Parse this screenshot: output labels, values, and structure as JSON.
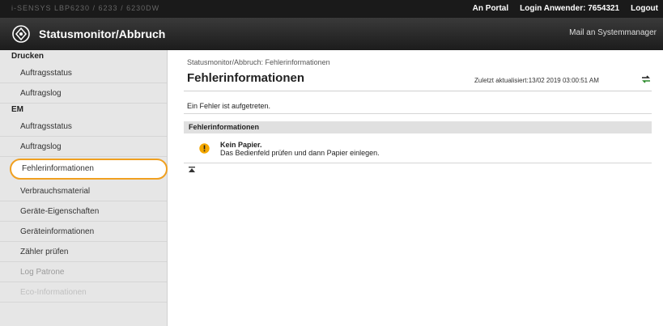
{
  "topbar": {
    "device_text": "i-SENSYS  LBP6230 / 6233 / 6230DW",
    "links": [
      "An Portal",
      "Login Anwender:  7654321",
      "Logout"
    ]
  },
  "titlebar": {
    "title": "Statusmonitor/Abbruch",
    "mail_link": "Mail an Systemmanager"
  },
  "sidebar": {
    "sections": [
      {
        "head": "Drucken",
        "items": [
          "Auftragsstatus",
          "Auftragslog"
        ]
      },
      {
        "head": "EM",
        "items": [
          "Auftragsstatus",
          "Auftragslog",
          "Fehlerinformationen",
          "Verbrauchsmaterial",
          "Geräte-Eigenschaften",
          "Geräteinformationen",
          "Zähler prüfen",
          "Log Patrone",
          "Eco-Informationen"
        ]
      }
    ]
  },
  "main": {
    "breadcrumb": "Statusmonitor/Abbruch: Fehlerinformationen",
    "page_title": "Fehlerinformationen",
    "last_updated": "Zuletzt aktualisiert:13/02 2019 03:00:51 AM",
    "message": "Ein Fehler ist aufgetreten.",
    "section_title": "Fehlerinformationen",
    "error_title": "Kein Papier.",
    "error_detail": "Das Bedienfeld prüfen und dann Papier einlegen."
  },
  "colors": {
    "accent_orange": "#f0a020",
    "header_dark": "#1a1a1a",
    "warning_yellow": "#f5a800"
  }
}
